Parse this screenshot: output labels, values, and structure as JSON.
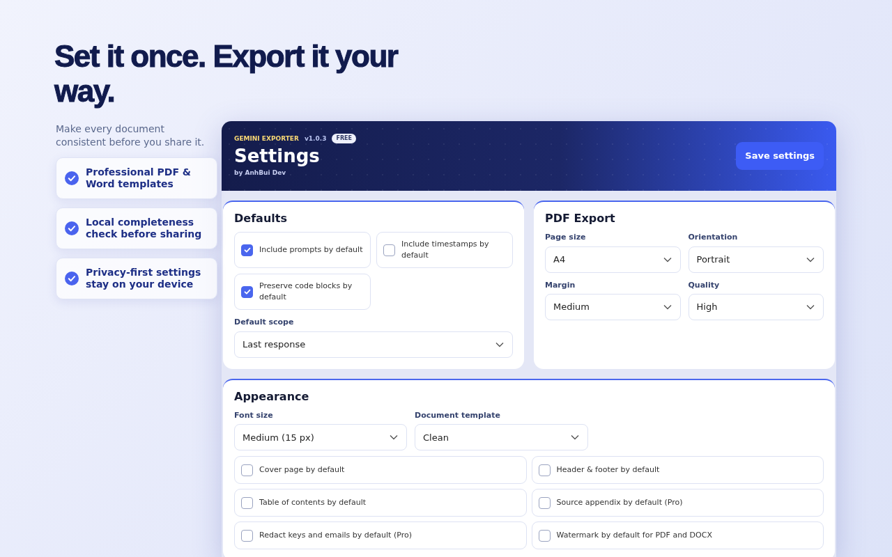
{
  "hero": {
    "headline": "Set it once. Export it your way.",
    "subtitle": "Make every document consistent before you share it.",
    "features": [
      "Professional PDF & Word templates",
      "Local completeness check before sharing",
      "Privacy-first settings stay on your device"
    ]
  },
  "header": {
    "brand": "GEMINI EXPORTER",
    "version": "v1.0.3",
    "badge": "FREE",
    "title": "Settings",
    "author": "by AnhBui Dev",
    "save_button": "Save settings"
  },
  "defaults": {
    "title": "Defaults",
    "options": [
      {
        "label": "Include prompts by default",
        "checked": true
      },
      {
        "label": "Include timestamps by default",
        "checked": false
      },
      {
        "label": "Preserve code blocks by default",
        "checked": true
      }
    ],
    "scope": {
      "label": "Default scope",
      "value": "Last response"
    }
  },
  "pdf_export": {
    "title": "PDF Export",
    "fields": [
      {
        "label": "Page size",
        "value": "A4"
      },
      {
        "label": "Orientation",
        "value": "Portrait"
      },
      {
        "label": "Margin",
        "value": "Medium"
      },
      {
        "label": "Quality",
        "value": "High"
      }
    ]
  },
  "appearance": {
    "title": "Appearance",
    "fields": [
      {
        "label": "Font size",
        "value": "Medium (15 px)"
      },
      {
        "label": "Document template",
        "value": "Clean"
      }
    ],
    "options": [
      {
        "label": "Cover page by default",
        "checked": false
      },
      {
        "label": "Header & footer by default",
        "checked": false
      },
      {
        "label": "Table of contents by default",
        "checked": false
      },
      {
        "label": "Source appendix by default (Pro)",
        "checked": false
      },
      {
        "label": "Redact keys and emails by default (Pro)",
        "checked": false
      },
      {
        "label": "Watermark by default for PDF and DOCX",
        "checked": false
      }
    ]
  }
}
